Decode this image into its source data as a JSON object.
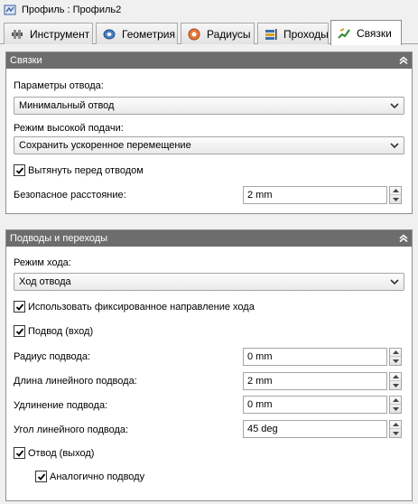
{
  "window": {
    "title": "Профиль : Профиль2"
  },
  "tabs": [
    {
      "label": "Инструмент",
      "icon": "tool-icon"
    },
    {
      "label": "Геометрия",
      "icon": "geometry-icon"
    },
    {
      "label": "Радиусы",
      "icon": "radii-icon"
    },
    {
      "label": "Проходы",
      "icon": "passes-icon"
    },
    {
      "label": "Связки",
      "icon": "linking-icon",
      "active": true
    }
  ],
  "linking": {
    "header": "Связки",
    "retract_params_label": "Параметры отвода:",
    "retract_params_value": "Минимальный отвод",
    "high_feed_label": "Режим высокой подачи:",
    "high_feed_value": "Сохранить ускоренное перемещение",
    "stretch_label": "Вытянуть перед отводом",
    "stretch_checked": true,
    "safe_distance_label": "Безопасное расстояние:",
    "safe_distance_value": "2 mm"
  },
  "leads": {
    "header": "Подводы и переходы",
    "ramp_mode_label": "Режим хода:",
    "ramp_mode_value": "Ход отвода",
    "fixed_direction_label": "Использовать фиксированное направление хода",
    "fixed_direction_checked": true,
    "lead_in_label": "Подвод (вход)",
    "lead_in_checked": true,
    "lead_in_radius_label": "Радиус подвода:",
    "lead_in_radius_value": "0 mm",
    "linear_lead_length_label": "Длина линейного подвода:",
    "linear_lead_length_value": "2 mm",
    "lead_extension_label": "Удлинение подвода:",
    "lead_extension_value": "0 mm",
    "linear_lead_angle_label": "Угол линейного подвода:",
    "linear_lead_angle_value": "45 deg",
    "lead_out_label": "Отвод (выход)",
    "lead_out_checked": true,
    "same_as_lead_in_label": "Аналогично подводу",
    "same_as_lead_in_checked": true
  },
  "colors": {
    "panel_header": "#6d6d6d",
    "background": "#f0f0f0"
  }
}
